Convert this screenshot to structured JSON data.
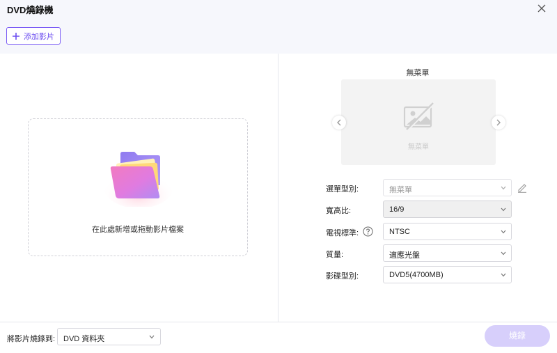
{
  "window": {
    "title": "DVD燒錄機"
  },
  "toolbar": {
    "add_video_label": "添加影片"
  },
  "drop_zone": {
    "text": "在此處新增或拖動影片檔案"
  },
  "menu_preview": {
    "title": "無菜單",
    "placeholder_text": "無菜單"
  },
  "settings": {
    "menu_type": {
      "label": "選單型別:",
      "value": "無菜單"
    },
    "aspect_ratio": {
      "label": "寬高比:",
      "value": "16/9"
    },
    "tv_standard": {
      "label": "電視標準:",
      "value": "NTSC"
    },
    "quality": {
      "label": "質量:",
      "value": "適應光盤"
    },
    "disc_type": {
      "label": "影碟型別:",
      "value": "DVD5(4700MB)"
    }
  },
  "footer": {
    "burn_to_label": "將影片燒錄到:",
    "burn_to_value": "DVD 資料夾",
    "burn_button_label": "燒錄"
  },
  "colors": {
    "accent": "#6c4ef0",
    "header_bg": "#f6f7fc",
    "burn_button_disabled": "#d7cffb"
  },
  "icons": [
    "close-icon",
    "plus-icon",
    "folder-icon",
    "no-image-icon",
    "chevron-left-icon",
    "chevron-right-icon",
    "chevron-down-icon",
    "help-icon",
    "edit-icon"
  ]
}
